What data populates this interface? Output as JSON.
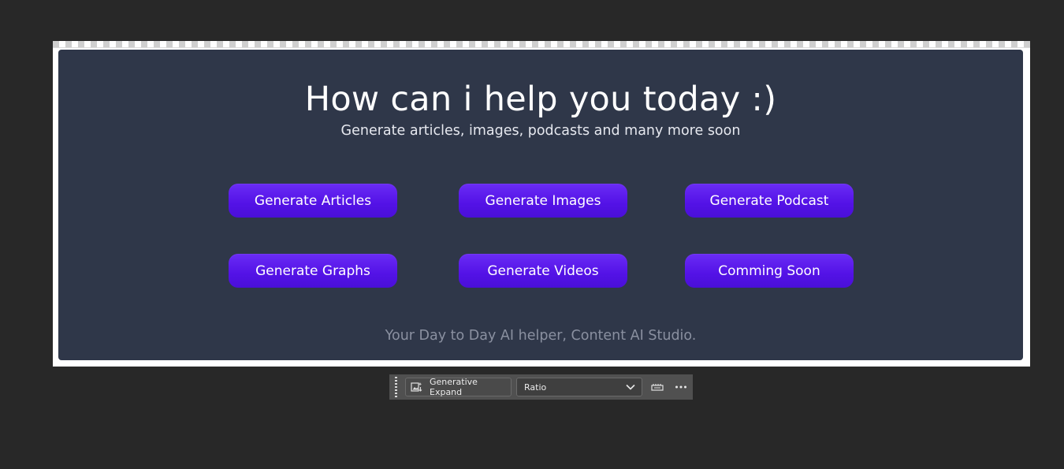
{
  "canvas": {
    "headline": "How can i help you today :)",
    "subhead": "Generate articles, images, podcasts and many more soon",
    "buttons": [
      {
        "label": "Generate Articles"
      },
      {
        "label": "Generate Images"
      },
      {
        "label": "Generate Podcast"
      },
      {
        "label": "Generate Graphs"
      },
      {
        "label": "Generate Videos"
      },
      {
        "label": "Comming Soon"
      }
    ],
    "footer": "Your Day to Day AI helper, Content AI Studio."
  },
  "taskbar": {
    "generative_expand_label": "Generative Expand",
    "ratio_value": "Ratio"
  },
  "colors": {
    "workspace_bg": "#282828",
    "panel_bg": "#2f3749",
    "button_accent": "#5312e6",
    "taskbar_bg": "#505050"
  },
  "icons": {
    "generative_expand": "generative-expand-icon",
    "dropdown": "chevron-down-icon",
    "tool": "tool-icon",
    "more": "more-options-icon",
    "grip": "drag-handle-icon"
  }
}
